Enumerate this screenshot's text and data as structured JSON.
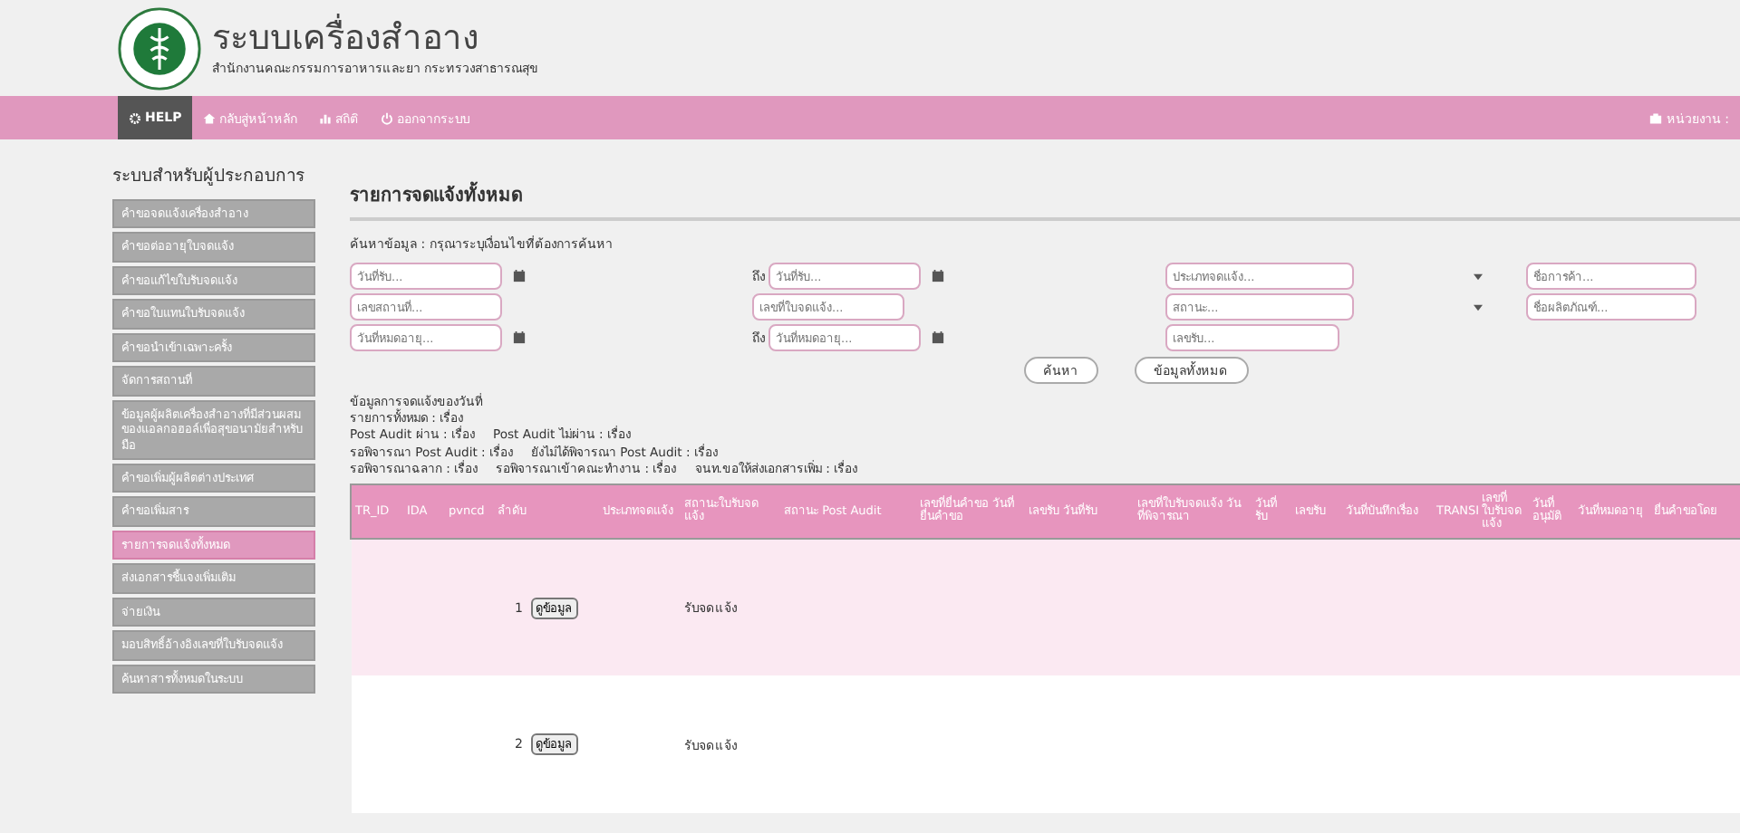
{
  "header": {
    "title": "ระบบเครื่องสำอาง",
    "subtitle": "สำนักงานคณะกรรมการอาหารและยา กระทรวงสาธารณสุข"
  },
  "nav": {
    "items": [
      {
        "label": "HELP",
        "selected": true
      },
      {
        "label": "กลับสู่หน้าหลัก",
        "selected": false
      },
      {
        "label": "สถิติ",
        "selected": false
      },
      {
        "label": "ออกจากระบบ",
        "selected": false
      }
    ],
    "right": "หน่วยงาน :"
  },
  "sidebar": {
    "title": "ระบบสำหรับผู้ประกอบการ",
    "items": [
      {
        "label": "คำขอจดแจ้งเครื่องสำอาง",
        "selected": false
      },
      {
        "label": "คำขอต่ออายุใบจดแจ้ง",
        "selected": false
      },
      {
        "label": "คำขอแก้ไขใบรับจดแจ้ง",
        "selected": false
      },
      {
        "label": "คำขอใบแทนใบรับจดแจ้ง",
        "selected": false
      },
      {
        "label": "คำขอนำเข้าเฉพาะครั้ง",
        "selected": false
      },
      {
        "label": "จัดการสถานที่",
        "selected": false
      },
      {
        "label": "ข้อมูลผู้ผลิตเครื่องสำอางที่มีส่วนผสมของแอลกอฮอล์เพื่อสุขอนามัยสำหรับมือ",
        "selected": false
      },
      {
        "label": "คำขอเพิ่มผู้ผลิตต่างประเทศ",
        "selected": false
      },
      {
        "label": "คำขอเพิ่มสาร",
        "selected": false
      },
      {
        "label": "รายการจดแจ้งทั้งหมด",
        "selected": true
      },
      {
        "label": "ส่งเอกสารชี้แจงเพิ่มเติม",
        "selected": false
      },
      {
        "label": "จ่ายเงิน",
        "selected": false
      },
      {
        "label": "มอบสิทธิ์อ้างอิงเลขที่ใบรับจดแจ้ง",
        "selected": false
      },
      {
        "label": "ค้นหาสารทั้งหมดในระบบ",
        "selected": false
      }
    ]
  },
  "page_title": "รายการจดแจ้งทั้งหมด",
  "search": {
    "label": "ค้นหาข้อมูล : กรุณาระบุเงื่อนไขที่ต้องการค้นหา",
    "rows": [
      [
        {
          "kind": "date",
          "placeholder": "วันที่รับ..."
        },
        {
          "kind": "date",
          "prefix": "ถึง",
          "placeholder": "วันที่รับ..."
        },
        {
          "kind": "select",
          "placeholder": "ประเภทจดแจ้ง..."
        },
        {
          "kind": "text",
          "placeholder": "ชื่อการค้า..."
        }
      ],
      [
        {
          "kind": "text",
          "placeholder": "เลขสถานที่..."
        },
        {
          "kind": "text",
          "placeholder": "เลขที่ใบจดแจ้ง..."
        },
        {
          "kind": "select",
          "placeholder": "สถานะ..."
        },
        {
          "kind": "text",
          "placeholder": "ชื่อผลิตภัณฑ์..."
        }
      ],
      [
        {
          "kind": "date",
          "placeholder": "วันที่หมดอายุ..."
        },
        {
          "kind": "date",
          "prefix": "ถึง",
          "placeholder": "วันที่หมดอายุ..."
        },
        {
          "kind": "text",
          "placeholder": "เลขรับ..."
        }
      ]
    ],
    "buttons": [
      "ค้นหา",
      "ข้อมูลทั้งหมด"
    ]
  },
  "summary": {
    "heading": "ข้อมูลการจดแจ้งของวันที่",
    "lines": [
      [
        "รายการทั้งหมด : เรื่อง"
      ],
      [
        "Post Audit ผ่าน : เรื่อง",
        "Post Audit ไม่ผ่าน : เรื่อง"
      ],
      [
        "รอพิจารณา Post Audit : เรื่อง",
        "ยังไม่ได้พิจารณา Post Audit : เรื่อง"
      ],
      [
        "รอพิจารณาฉลาก : เรื่อง",
        "รอพิจารณาเข้าคณะทำงาน : เรื่อง",
        "จนท.ขอให้ส่งเอกสารเพิ่ม : เรื่อง"
      ]
    ]
  },
  "table": {
    "columns": [
      "TR_ID",
      "IDA",
      "pvncd",
      "ลำดับ",
      "",
      "ประเภทจดแจ้ง",
      "สถานะใบรับจดแจ้ง",
      "สถานะ Post Audit",
      "เลขที่ยื่นคำขอ วันที่ยื่นคำขอ",
      "เลขรับ วันที่รับ",
      "เลขที่ใบรับจดแจ้ง วันที่พิจารณา",
      "วันที่รับ",
      "เลขรับ",
      "วันที่บันทึกเรื่อง",
      "TRANSI",
      "เลขที่ใบรับจดแจ้ง",
      "วันที่อนุมัติ",
      "วันที่หมดอายุ",
      "ยื่นคำขอโดย"
    ],
    "rows": [
      {
        "number": "1",
        "action": "ดูข้อมูล",
        "status": "รับจดแจ้ง"
      },
      {
        "number": "2",
        "action": "ดูข้อมูล",
        "status": "รับจดแจ้ง"
      }
    ]
  }
}
